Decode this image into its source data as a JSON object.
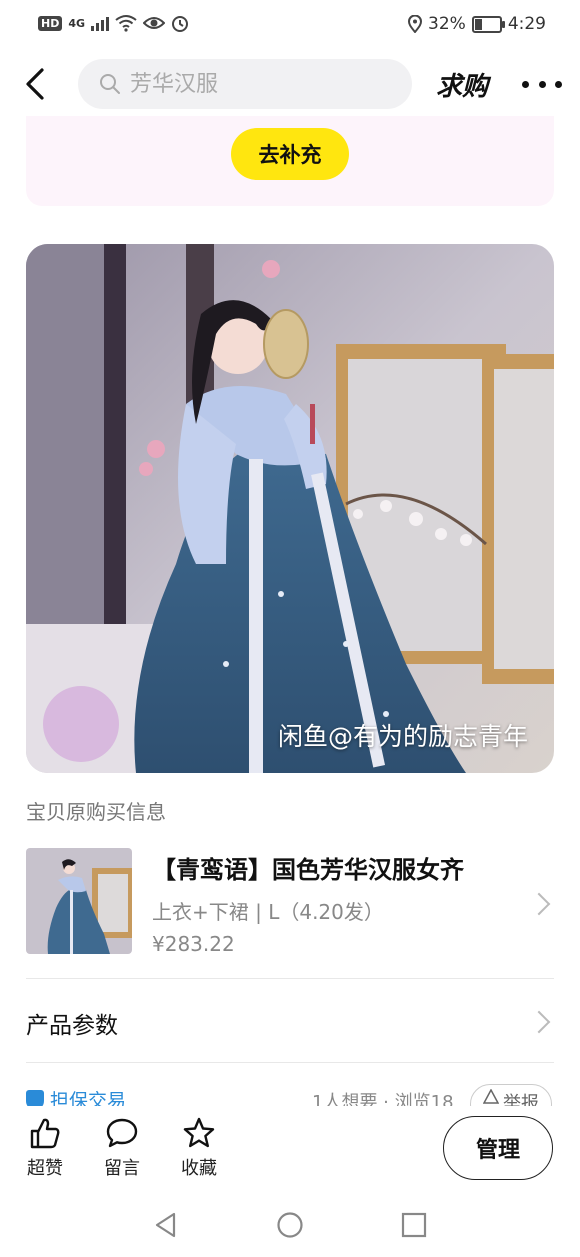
{
  "status_bar": {
    "left_badge": "HD",
    "network": "4G",
    "battery_text": "32%",
    "battery_level": 0.32,
    "time": "4:29"
  },
  "nav": {
    "search_placeholder": "芳华汉服",
    "want_label": "求购",
    "icons": [
      "back-arrow-icon",
      "search-icon",
      "more-icon"
    ]
  },
  "supplement": {
    "button_label": "去补充"
  },
  "main_image": {
    "watermark": "闲鱼@有为的励志青年"
  },
  "original_purchase": {
    "section_title": "宝贝原购买信息",
    "title": "【青鸾语】国色芳华汉服女齐",
    "variant": "上衣+下裙 | L（4.20发）",
    "price": "¥283.22"
  },
  "params": {
    "label": "产品参数"
  },
  "info": {
    "guarantee": "担保交易",
    "stats": "1人想要 · 浏览18",
    "report": "举报"
  },
  "actions": [
    {
      "label": "超赞",
      "icon": "thumbs-up-icon"
    },
    {
      "label": "留言",
      "icon": "comment-icon"
    },
    {
      "label": "收藏",
      "icon": "star-icon"
    }
  ],
  "manage_button": "管理",
  "colors": {
    "accent_yellow": "#ffe60f",
    "card_pink": "#fdf4fb",
    "link_blue": "#2a8bd8"
  }
}
